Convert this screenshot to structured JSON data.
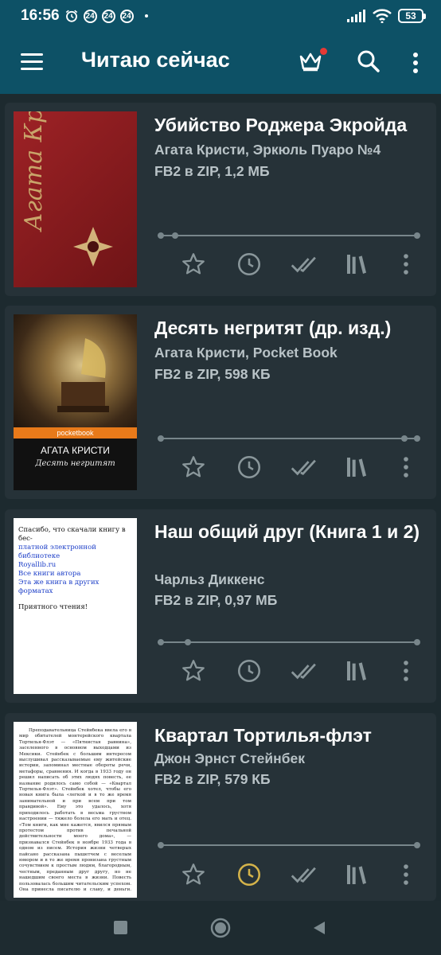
{
  "status_bar": {
    "time": "16:56",
    "notif_badges": [
      "24",
      "24",
      "24"
    ],
    "battery": "53"
  },
  "app_bar": {
    "title": "Читаю сейчас",
    "icons": [
      "menu-icon",
      "crown-icon",
      "search-icon",
      "more-vert-icon"
    ],
    "notification_dot_color": "#e53935"
  },
  "books": [
    {
      "title": "Убийство Роджера Экройда",
      "author": "Агата Кристи, Эркюль Пуаро №4",
      "meta": "FB2 в ZIP, 1,2 МБ",
      "cover": {
        "vertical_text": "Агата Кристи",
        "bg": "#8b1c1f"
      },
      "history_active": false
    },
    {
      "title": "Десять негритят (др. изд.)",
      "author": "Агата Кристи, Pocket Book",
      "meta": "FB2 в ZIP, 598 КБ",
      "cover": {
        "series": "pocketbook",
        "author": "АГАТА КРИСТИ",
        "title": "Десять негритят"
      },
      "history_active": false
    },
    {
      "title": "Наш общий друг (Книга 1 и 2)",
      "author": "Чарльз Диккенс",
      "meta": "FB2 в ZIP, 0,97 МБ",
      "cover": {
        "lines": [
          "Спасибо, что скачали книгу в бес-",
          "платной электронной библиотеке",
          "Royallib.ru",
          "Все книги автора",
          "Эта же книга в других форматах",
          "Приятного чтения!"
        ]
      },
      "history_active": false
    },
    {
      "title": "Квартал Тортилья-флэт",
      "author": "Джон Эрнст Стейнбек",
      "meta": "FB2 в ZIP, 579 КБ",
      "cover": {
        "text": "Преподавательница Стейнбека ввела его в мир обитателей монтерейского квартала Тортилья-Флэт — «Пятнистая равнина», заселенного в основном выходцами из Мексики. Стейнбек с большим интересом выслушивал рассказываемые ему житейские истории, запоминал местные обороты речи, метафоры, сравнения. И когда в 1933 году он решил написать об этих людях повесть, ее название родилось само собой — «Квартал Тортилья-Флэт». Стейнбек хотел, чтобы его новая книга была «легкой и в то же время занимательной и при всем при том правдивой». Ему это удалось, хотя приходилось работать в весьма грустном настроении — тяжело болела его мать и отец. «Том книги, как мне кажется, явился прямым протестом против печальной действительности моего дома», — признавался Стейнбек в ноябре 1933 года в одном из писем. История жизни четверых пайсано рассказана пышетчем с веселым юмором и в то же время пронизана грустным сочувствием к простым людям, благородным, честным, преданным друг другу, но не нашедшим своего места в жизни. Повесть пользовалась большим читательским успехом. Она принесла писателю и славу, и деньги. Рассказ о"
      },
      "history_active": true
    }
  ],
  "colors": {
    "app_bar": "#0d5166",
    "background": "#1d2a2f",
    "card": "#263238",
    "icon": "#8a979b",
    "history_active": "#d4b34a"
  }
}
